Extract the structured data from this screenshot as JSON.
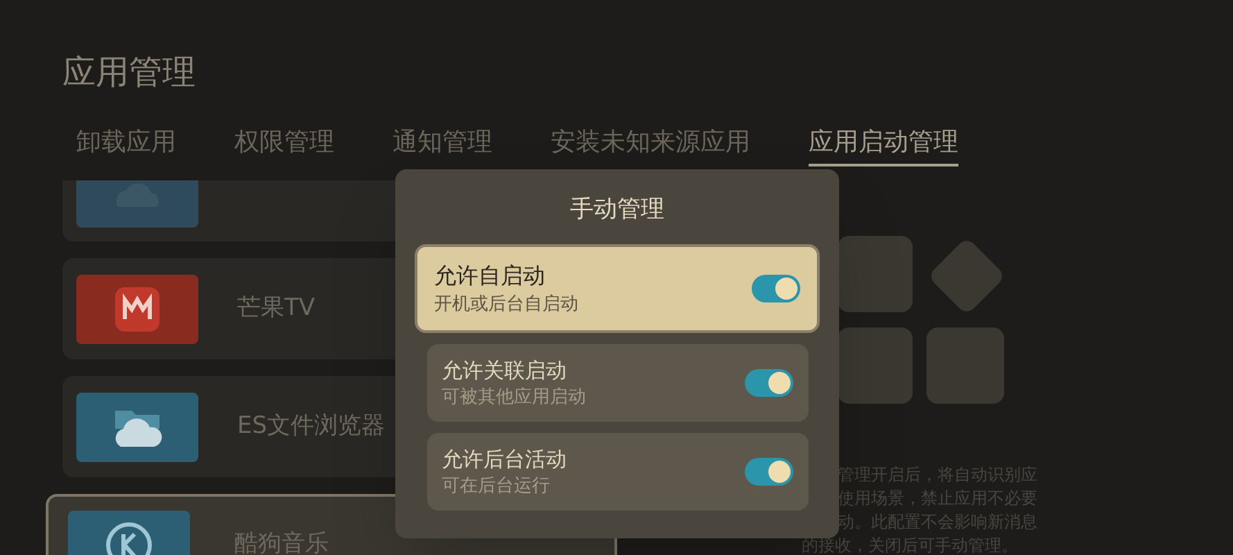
{
  "page": {
    "title": "应用管理"
  },
  "tabs": [
    {
      "label": "卸载应用",
      "selected": false
    },
    {
      "label": "权限管理",
      "selected": false
    },
    {
      "label": "通知管理",
      "selected": false
    },
    {
      "label": "安装未知来源应用",
      "selected": false
    },
    {
      "label": "应用启动管理",
      "selected": true
    }
  ],
  "apps": [
    {
      "kind": "cloud",
      "color": "#2f4a5a",
      "selected": false
    },
    {
      "kind": "mango",
      "name": "芒果TV",
      "color": "#8a2b1f",
      "selected": false
    },
    {
      "kind": "es",
      "name": "ES文件浏览器",
      "color": "#2c5f73",
      "selected": false
    },
    {
      "kind": "kugou",
      "name": "酷狗音乐",
      "color": "#2c5f73",
      "selected": true
    }
  ],
  "description": [
    "管理开启后，将自动识别应",
    "使用场景，禁止应用不必要",
    "动。此配置不会影响新消息",
    "的接收，关闭后可手动管理。"
  ],
  "dialog": {
    "title": "手动管理",
    "options": [
      {
        "title": "允许自启动",
        "subtitle": "开机或后台自启动",
        "on": true,
        "selected": true
      },
      {
        "title": "允许关联启动",
        "subtitle": "可被其他应用启动",
        "on": true,
        "selected": false
      },
      {
        "title": "允许后台活动",
        "subtitle": "可在后台运行",
        "on": true,
        "selected": false
      }
    ]
  }
}
